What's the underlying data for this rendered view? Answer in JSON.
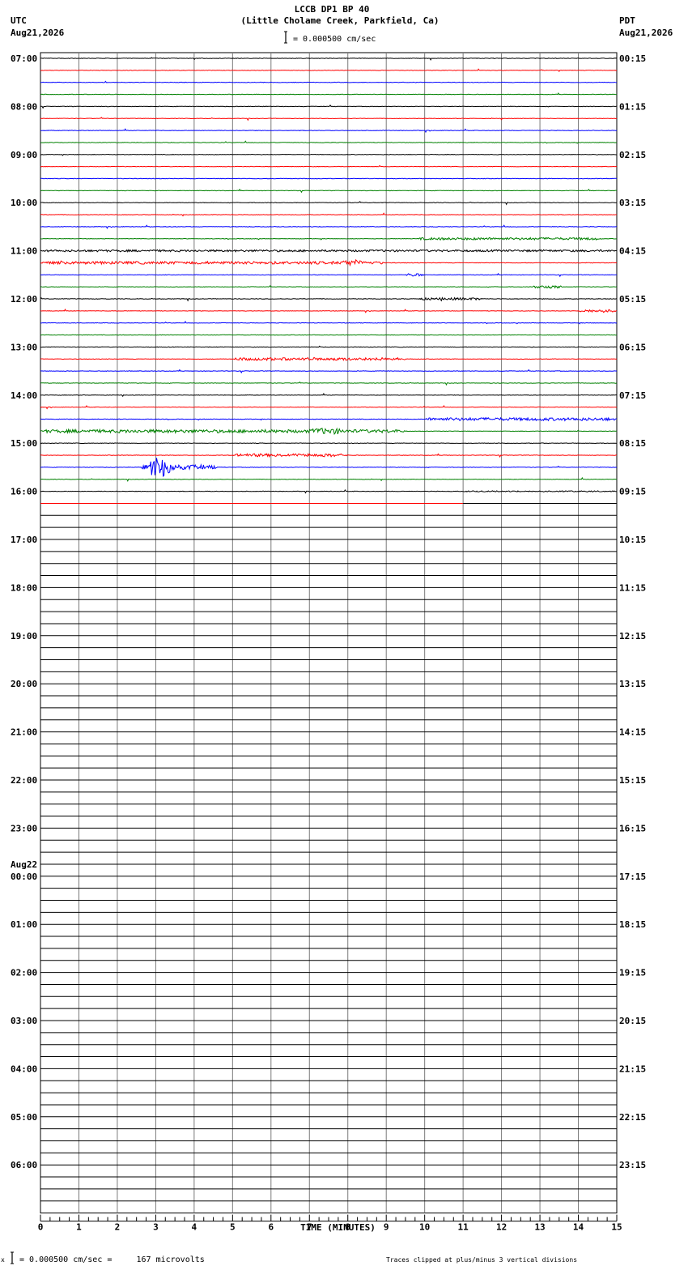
{
  "header": {
    "title": "LCCB DP1 BP 40",
    "subtitle": "(Little Cholame Creek, Parkfield, Ca)",
    "scale_text": "= 0.000500 cm/sec",
    "left_tz": "UTC",
    "left_date": "Aug21,2026",
    "right_tz": "PDT",
    "right_date": "Aug21,2026"
  },
  "footer": {
    "scale_note": "= 0.000500 cm/sec =     167 microvolts",
    "clip_note": "Traces clipped at plus/minus 3 vertical divisions",
    "corner_mark": "x"
  },
  "chart_data": {
    "type": "line",
    "title": "LCCB DP1 BP 40",
    "xlabel": "TIME (MINUTES)",
    "xlim": [
      0,
      15
    ],
    "x_ticks": [
      "0",
      "1",
      "2",
      "3",
      "4",
      "5",
      "6",
      "7",
      "8",
      "9",
      "10",
      "11",
      "12",
      "13",
      "14",
      "15"
    ],
    "traces_per_hour": 4,
    "total_traces": 96,
    "trace_colors": [
      "#000000",
      "#ff0000",
      "#0000ff",
      "#008000"
    ],
    "left_hour_labels": [
      "07:00",
      "08:00",
      "09:00",
      "10:00",
      "11:00",
      "12:00",
      "13:00",
      "14:00",
      "15:00",
      "16:00",
      "17:00",
      "18:00",
      "19:00",
      "20:00",
      "21:00",
      "22:00",
      "23:00",
      "00:00",
      "01:00",
      "02:00",
      "03:00",
      "04:00",
      "05:00",
      "06:00"
    ],
    "right_hour_labels": [
      "00:15",
      "01:15",
      "02:15",
      "03:15",
      "04:15",
      "05:15",
      "06:15",
      "07:15",
      "08:15",
      "09:15",
      "10:15",
      "11:15",
      "12:15",
      "13:15",
      "14:15",
      "15:15",
      "16:15",
      "17:15",
      "18:15",
      "19:15",
      "20:15",
      "21:15",
      "22:15",
      "23:15"
    ],
    "date_change": {
      "hour_index": 17,
      "label": "Aug22"
    },
    "last_trace": {
      "index": 37,
      "end_minute": 11,
      "color": "#ff0000"
    },
    "events": [
      {
        "trace": 15,
        "start": 9.8,
        "end": 14.6,
        "amp": 0.15
      },
      {
        "trace": 16,
        "start": 0.0,
        "end": 15.0,
        "amp": 0.12
      },
      {
        "trace": 17,
        "start": 0.0,
        "end": 9.0,
        "amp": 0.18
      },
      {
        "trace": 17,
        "start": 7.8,
        "end": 8.4,
        "amp": 0.45
      },
      {
        "trace": 18,
        "start": 9.5,
        "end": 10.0,
        "amp": 0.2
      },
      {
        "trace": 19,
        "start": 12.8,
        "end": 13.6,
        "amp": 0.2
      },
      {
        "trace": 20,
        "start": 9.8,
        "end": 11.5,
        "amp": 0.15
      },
      {
        "trace": 21,
        "start": 14.0,
        "end": 15.0,
        "amp": 0.2
      },
      {
        "trace": 25,
        "start": 5.0,
        "end": 9.5,
        "amp": 0.18
      },
      {
        "trace": 30,
        "start": 10.0,
        "end": 15.0,
        "amp": 0.2
      },
      {
        "trace": 31,
        "start": 0.0,
        "end": 9.5,
        "amp": 0.22
      },
      {
        "trace": 31,
        "start": 7.0,
        "end": 7.9,
        "amp": 0.45
      },
      {
        "trace": 33,
        "start": 5.0,
        "end": 8.0,
        "amp": 0.2
      },
      {
        "trace": 34,
        "start": 2.6,
        "end": 4.6,
        "amp": 0.35
      },
      {
        "trace": 34,
        "start": 2.8,
        "end": 3.5,
        "amp": 1.6
      },
      {
        "trace": 36,
        "start": 11.0,
        "end": 15.0,
        "amp": 0.05
      }
    ]
  }
}
